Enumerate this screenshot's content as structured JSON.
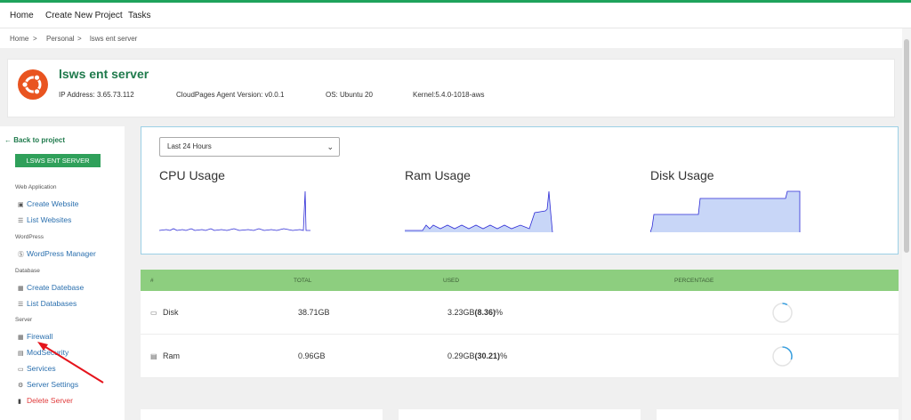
{
  "nav": {
    "home": "Home",
    "create_project": "Create New Project",
    "tasks": "Tasks"
  },
  "breadcrumb": {
    "home": "Home",
    "sep": ">",
    "personal": "Personal",
    "server": "lsws ent server"
  },
  "server": {
    "name": "lsws ent server",
    "ip": "IP Address: 3.65.73.112",
    "agent": "CloudPages Agent Version: v0.0.1",
    "os": "OS: Ubuntu 20",
    "kernel": "Kernel:5.4.0-1018-aws"
  },
  "sidebar": {
    "back": "Back to project",
    "server_button": "LSWS ENT SERVER",
    "sections": {
      "web": "Web Application",
      "wp": "WordPress",
      "db": "Database",
      "server": "Server"
    },
    "links": {
      "create_website": "Create Website",
      "list_websites": "List Websites",
      "wp_manager": "WordPress Manager",
      "create_db": "Create Datebase",
      "list_db": "List Databases",
      "firewall": "Firewall",
      "modsecurity": "ModSecurity",
      "services": "Services",
      "server_settings": "Server Settings",
      "delete_server": "Delete Server"
    },
    "icons": {
      "create_website": "browser-icon",
      "list_websites": "list-icon",
      "wp_manager": "wordpress-icon",
      "create_db": "database-icon",
      "list_db": "list-icon",
      "firewall": "firewall-icon",
      "modsecurity": "shield-icon",
      "services": "window-icon",
      "server_settings": "gear-icon",
      "delete_server": "trash-icon"
    }
  },
  "usage": {
    "range": "Last 24 Hours",
    "cpu": "CPU Usage",
    "ram": "Ram Usage",
    "disk": "Disk Usage"
  },
  "table": {
    "headers": {
      "num": "#",
      "total": "TOTAL",
      "used": "USED",
      "percentage": "PERCENTAGE"
    },
    "rows": [
      {
        "label": "Disk",
        "total": "38.71GB",
        "used": "3.23GB",
        "pct": "(8.36)",
        "pct_suffix": "%",
        "fraction": 0.0836
      },
      {
        "label": "Ram",
        "total": "0.96GB",
        "used": "0.29GB",
        "pct": "(30.21)",
        "pct_suffix": "%",
        "fraction": 0.3021
      }
    ]
  },
  "colors": {
    "accent": "#1fa35c",
    "header_green": "#8dce7f",
    "link": "#2a6fae",
    "danger": "#e03b3b",
    "chart_line": "#2d2bd6",
    "chart_fill": "#c8d6f7"
  }
}
